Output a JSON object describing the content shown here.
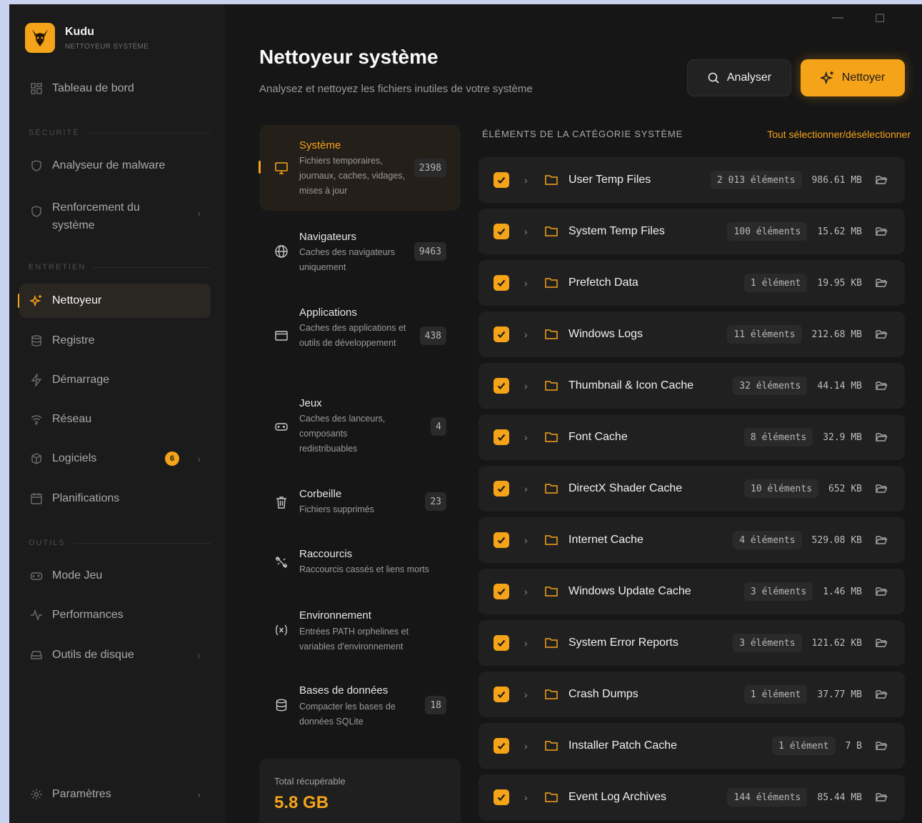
{
  "app": {
    "name": "Kudu",
    "subtitle": "NETTOYEUR SYSTÈME"
  },
  "colors": {
    "accent": "#f5a319",
    "background": "#161616",
    "sidebar": "#1b1b1b"
  },
  "sidebar": {
    "dashboard": "Tableau de bord",
    "sections": {
      "security": "SÉCURITÉ",
      "maintenance": "ENTRETIEN",
      "tools": "OUTILS"
    },
    "security_items": [
      {
        "label": "Analyseur de malware",
        "icon": "shield-icon"
      },
      {
        "label": "Renforcement du système",
        "icon": "shield-icon"
      }
    ],
    "maintenance_items": [
      {
        "label": "Nettoyeur",
        "icon": "sparkles-icon",
        "active": true
      },
      {
        "label": "Registre",
        "icon": "database-icon"
      },
      {
        "label": "Démarrage",
        "icon": "lightning-icon"
      },
      {
        "label": "Réseau",
        "icon": "wifi-icon"
      },
      {
        "label": "Logiciels",
        "icon": "package-icon",
        "badge": "6"
      },
      {
        "label": "Planifications",
        "icon": "calendar-icon"
      }
    ],
    "tools_items": [
      {
        "label": "Mode Jeu",
        "icon": "gamepad-icon"
      },
      {
        "label": "Performances",
        "icon": "activity-icon"
      },
      {
        "label": "Outils de disque",
        "icon": "hard-drive-icon"
      }
    ],
    "settings": "Paramètres"
  },
  "header": {
    "title": "Nettoyeur système",
    "subtitle": "Analysez et nettoyez les fichiers inutiles de votre système",
    "analyze_label": "Analyser",
    "clean_label": "Nettoyer"
  },
  "categories": [
    {
      "title": "Système",
      "desc": "Fichiers temporaires, journaux, caches, vidages, mises à jour",
      "count": "2398",
      "icon": "monitor-icon",
      "active": true
    },
    {
      "title": "Navigateurs",
      "desc": "Caches des navigateurs uniquement",
      "count": "9463",
      "icon": "globe-icon"
    },
    {
      "title": "Applications",
      "desc": "Caches des applications et outils de développement",
      "count": "438",
      "icon": "app-window-icon"
    },
    {
      "title": "Jeux",
      "desc": "Caches des lanceurs, composants redistribuables",
      "count": "4",
      "icon": "gamepad-icon"
    },
    {
      "title": "Corbeille",
      "desc": "Fichiers supprimés",
      "count": "23",
      "icon": "trash-icon"
    },
    {
      "title": "Raccourcis",
      "desc": "Raccourcis cassés et liens morts",
      "count": "",
      "icon": "broken-link-icon"
    },
    {
      "title": "Environnement",
      "desc": "Entrées PATH orphelines et variables d'environnement",
      "count": "",
      "icon": "variable-icon"
    },
    {
      "title": "Bases de données",
      "desc": "Compacter les bases de données SQLite",
      "count": "18",
      "icon": "database-icon"
    }
  ],
  "total": {
    "label": "Total récupérable",
    "value": "5.8 GB"
  },
  "list": {
    "header": "ÉLÉMENTS DE LA CATÉGORIE SYSTÈME",
    "select_all": "Tout sélectionner/désélectionner",
    "items": [
      {
        "name": "User Temp Files",
        "count": "2 013 éléments",
        "size": "986.61 MB"
      },
      {
        "name": "System Temp Files",
        "count": "100 éléments",
        "size": "15.62 MB"
      },
      {
        "name": "Prefetch Data",
        "count": "1 élément",
        "size": "19.95 KB"
      },
      {
        "name": "Windows Logs",
        "count": "11 éléments",
        "size": "212.68 MB"
      },
      {
        "name": "Thumbnail & Icon Cache",
        "count": "32 éléments",
        "size": "44.14 MB"
      },
      {
        "name": "Font Cache",
        "count": "8 éléments",
        "size": "32.9 MB"
      },
      {
        "name": "DirectX Shader Cache",
        "count": "10 éléments",
        "size": "652 KB"
      },
      {
        "name": "Internet Cache",
        "count": "4 éléments",
        "size": "529.08 KB"
      },
      {
        "name": "Windows Update Cache",
        "count": "3 éléments",
        "size": "1.46 MB"
      },
      {
        "name": "System Error Reports",
        "count": "3 éléments",
        "size": "121.62 KB"
      },
      {
        "name": "Crash Dumps",
        "count": "1 élément",
        "size": "37.77 MB"
      },
      {
        "name": "Installer Patch Cache",
        "count": "1 élément",
        "size": "7 B"
      },
      {
        "name": "Event Log Archives",
        "count": "144 éléments",
        "size": "85.44 MB"
      }
    ]
  }
}
